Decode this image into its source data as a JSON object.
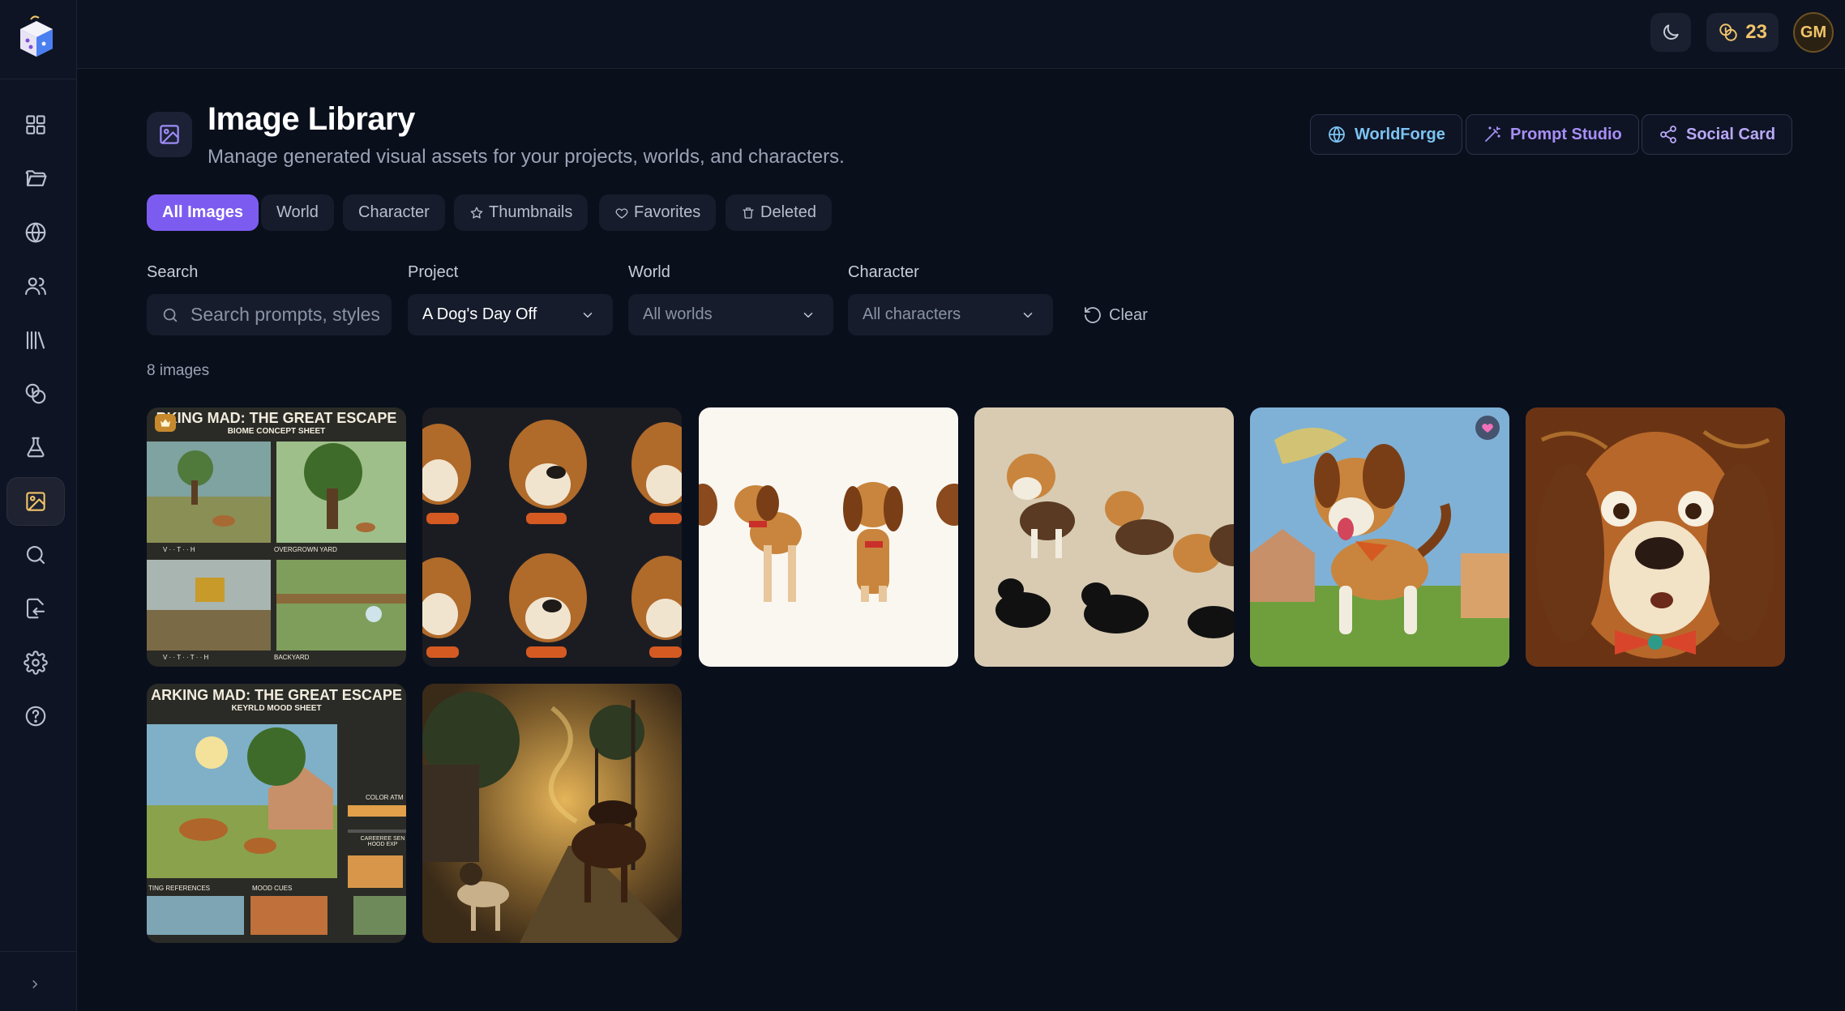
{
  "header": {
    "title": "Image Library",
    "subtitle": "Manage generated visual assets for your projects, worlds, and characters."
  },
  "topbar": {
    "credits": "23",
    "avatar_initials": "GM"
  },
  "actions": [
    {
      "label": "WorldForge",
      "color": "#7cc4f2"
    },
    {
      "label": "Prompt Studio",
      "color": "#a88ff5"
    },
    {
      "label": "Social Card",
      "color": "#b9a8f7"
    }
  ],
  "tabs": [
    "All Images",
    "World",
    "Character",
    "Thumbnails",
    "Favorites",
    "Deleted"
  ],
  "filters": {
    "search_label": "Search",
    "search_placeholder": "Search prompts, styles...",
    "project_label": "Project",
    "project_value": "A Dog's Day Off",
    "world_label": "World",
    "world_value": "All worlds",
    "character_label": "Character",
    "character_value": "All characters",
    "clear_label": "Clear"
  },
  "image_count": "8 images",
  "images": [
    {
      "title": "RKING MAD: THE GREAT ESCAPE",
      "subtitle": "BIOME CONCEPT SHEET",
      "panels": [
        "V · · T · · H",
        "OVERGROWN YARD",
        "V · · T · · T · · H",
        "BACKYARD"
      ]
    },
    {
      "title": "",
      "subtitle": "",
      "panels": []
    },
    {
      "title": "",
      "subtitle": "",
      "panels": []
    },
    {
      "title": "",
      "subtitle": "",
      "panels": []
    },
    {
      "title": "",
      "subtitle": "",
      "panels": []
    },
    {
      "title": "",
      "subtitle": "",
      "panels": []
    },
    {
      "title": "ARKING MAD: THE GREAT ESCAPE",
      "subtitle": "KEYRLD MOOD SHEET",
      "panels": [
        "TING REFERENCES",
        "MOOD CUES",
        "COLOR ATM",
        "CAREEREE SEN HOOD EXP"
      ]
    },
    {
      "title": "",
      "subtitle": "",
      "panels": []
    }
  ],
  "colors": {
    "accent": "#7c5cf0",
    "gold": "#f0c46a",
    "background": "#0a0f1c"
  },
  "icons": {
    "sidebar": [
      "dashboard-icon",
      "folder-icon",
      "globe-icon",
      "users-icon",
      "library-icon",
      "coins-icon",
      "flask-icon",
      "image-icon",
      "search-icon",
      "export-icon",
      "settings-icon",
      "help-icon"
    ]
  }
}
